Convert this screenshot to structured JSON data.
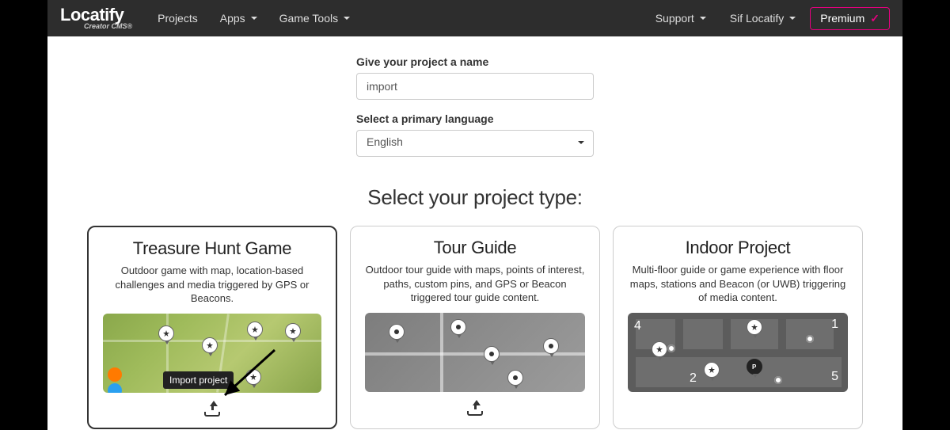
{
  "nav": {
    "brand": "Locatify",
    "brand_sub": "Creator CMS®",
    "items": [
      {
        "label": "Projects",
        "dropdown": false
      },
      {
        "label": "Apps",
        "dropdown": true
      },
      {
        "label": "Game Tools",
        "dropdown": true
      }
    ],
    "support": "Support",
    "user": "Sif Locatify",
    "premium": "Premium"
  },
  "form": {
    "name_label": "Give your project a name",
    "name_value": "import",
    "lang_label": "Select a primary language",
    "lang_value": "English"
  },
  "section_title": "Select your project type:",
  "cards": [
    {
      "title": "Treasure Hunt Game",
      "desc": "Outdoor game with map, location-based challenges and media triggered by GPS or Beacons.",
      "selected": true,
      "has_import": true
    },
    {
      "title": "Tour Guide",
      "desc": "Outdoor tour guide with maps, points of interest, paths, custom pins, and GPS or Beacon triggered tour guide content.",
      "selected": false,
      "has_import": true
    },
    {
      "title": "Indoor Project",
      "desc": "Multi-floor guide or game experience with floor maps, stations and Beacon (or UWB) triggering of media content.",
      "selected": false,
      "has_import": false
    }
  ],
  "tooltip": "Import project"
}
